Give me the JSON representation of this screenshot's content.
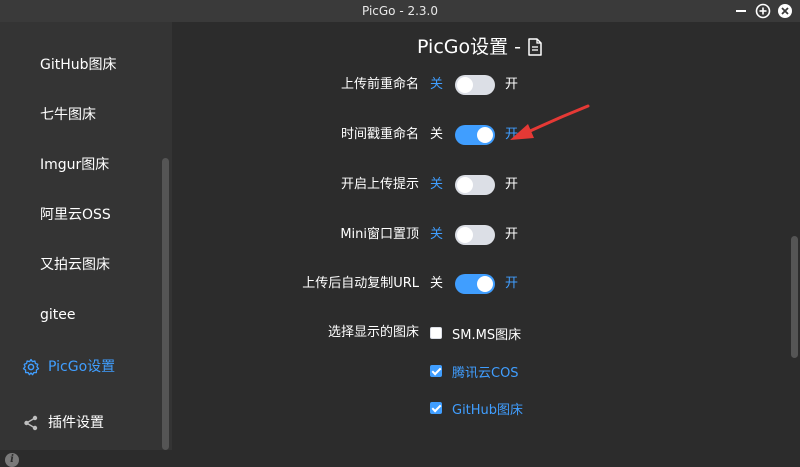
{
  "window": {
    "title": "PicGo - 2.3.0",
    "controls": [
      "minimize-icon",
      "maximize-icon",
      "close-icon"
    ]
  },
  "sidebar": {
    "items": [
      {
        "label": "GitHub图床",
        "active": false
      },
      {
        "label": "七牛图床",
        "active": false
      },
      {
        "label": "Imgur图床",
        "active": false
      },
      {
        "label": "阿里云OSS",
        "active": false
      },
      {
        "label": "又拍云图床",
        "active": false
      },
      {
        "label": "gitee",
        "active": false
      },
      {
        "label": "PicGo设置",
        "active": true,
        "icon": "gear-icon"
      },
      {
        "label": "插件设置",
        "active": false,
        "icon": "share-icon"
      }
    ],
    "info_icon": "info-icon"
  },
  "main": {
    "title": "PicGo设置 -",
    "title_icon": "document-icon",
    "off_label": "关",
    "on_label": "开",
    "settings": [
      {
        "label": "上传前重命名",
        "on": false
      },
      {
        "label": "时间戳重命名",
        "on": true
      },
      {
        "label": "开启上传提示",
        "on": false
      },
      {
        "label": "Mini窗口置顶",
        "on": false
      },
      {
        "label": "上传后自动复制URL",
        "on": true
      }
    ],
    "picbed_select": {
      "label": "选择显示的图床",
      "options": [
        {
          "label": "SM.MS图床",
          "checked": false
        },
        {
          "label": "腾讯云COS",
          "checked": true
        },
        {
          "label": "GitHub图床",
          "checked": true
        }
      ]
    }
  },
  "colors": {
    "accent": "#409eff",
    "annotation_arrow": "#e53935",
    "background": "#2c2c2c",
    "sidebar": "#343434"
  }
}
